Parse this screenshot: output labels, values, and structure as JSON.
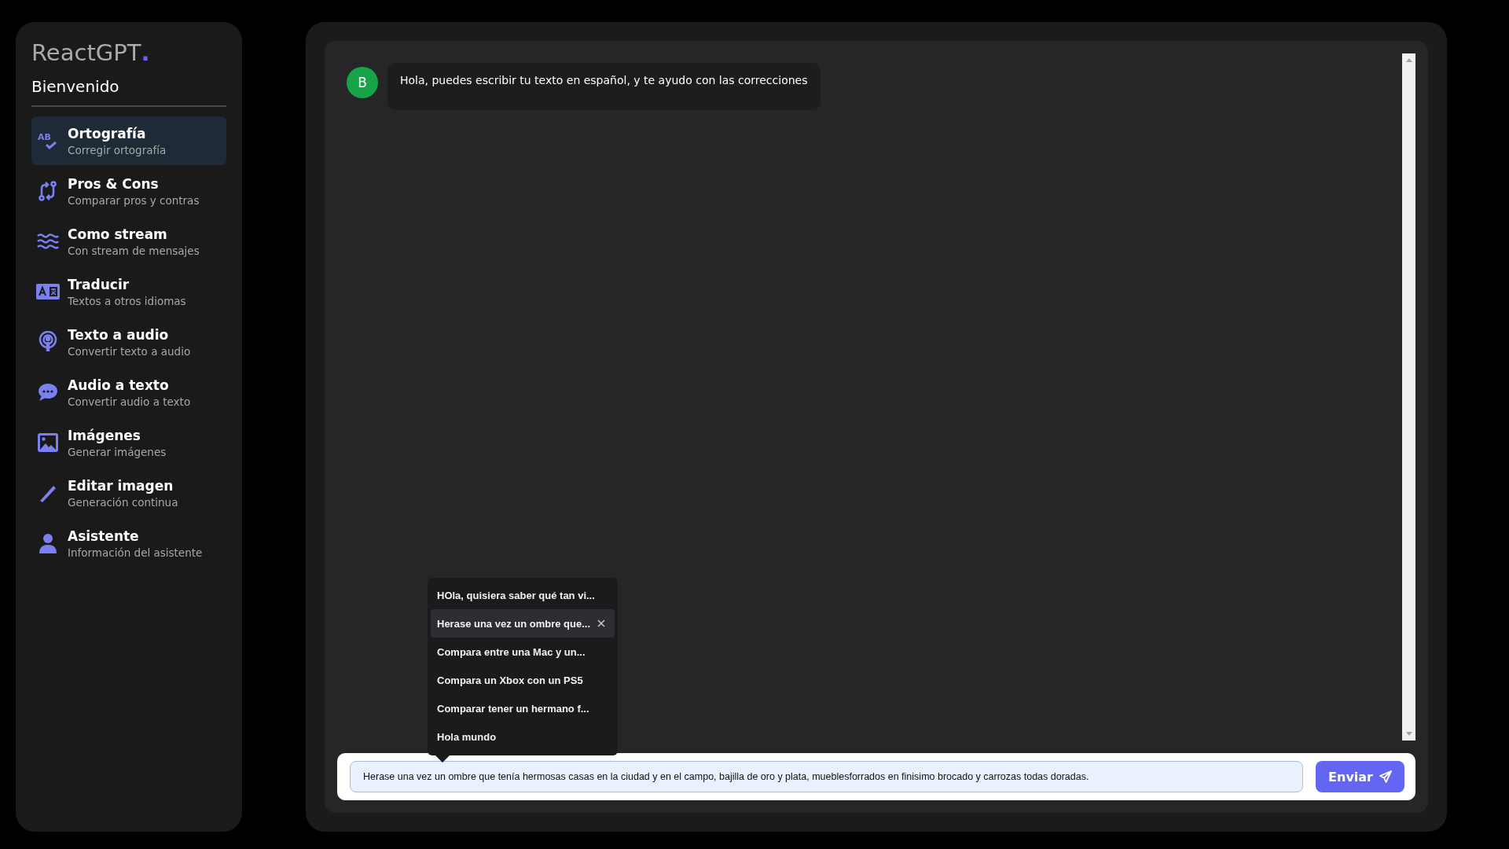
{
  "brand": {
    "name": "ReactGPT",
    "dot": "."
  },
  "greeting": "Bienvenido",
  "menu": [
    {
      "icon_text": "AB",
      "title": "Ortografía",
      "subtitle": "Corregir ortografía",
      "selected": true
    },
    {
      "title": "Pros & Cons",
      "subtitle": "Comparar pros y contras",
      "selected": false
    },
    {
      "title": "Como stream",
      "subtitle": "Con stream de mensajes",
      "selected": false
    },
    {
      "title": "Traducir",
      "subtitle": "Textos a otros idiomas",
      "selected": false
    },
    {
      "title": "Texto a audio",
      "subtitle": "Convertir texto a audio",
      "selected": false
    },
    {
      "title": "Audio a texto",
      "subtitle": "Convertir audio a texto",
      "selected": false
    },
    {
      "title": "Imágenes",
      "subtitle": "Generar imágenes",
      "selected": false
    },
    {
      "title": "Editar imagen",
      "subtitle": "Generación continua",
      "selected": false
    },
    {
      "title": "Asistente",
      "subtitle": "Información del asistente",
      "selected": false
    }
  ],
  "messages": [
    {
      "avatar": "B",
      "text": "Hola, puedes escribir tu texto en español, y te ayudo con las correcciones"
    }
  ],
  "history": [
    {
      "text": "HOla, quisiera saber qué tan vi...",
      "selected": false
    },
    {
      "text": "Herase una vez un ombre que...",
      "selected": true
    },
    {
      "text": "Compara entre una Mac y un...",
      "selected": false
    },
    {
      "text": "Compara un Xbox con un PS5",
      "selected": false
    },
    {
      "text": "Comparar tener un hermano f...",
      "selected": false
    },
    {
      "text": "Hola mundo",
      "selected": false
    }
  ],
  "input": {
    "value": "Herase una vez un ombre que tenía hermosas casas en la ciudad y en el campo, bajilla de oro y plata, mueblesforrados en finisimo brocado y carrozas todas doradas."
  },
  "send_button": "Enviar"
}
